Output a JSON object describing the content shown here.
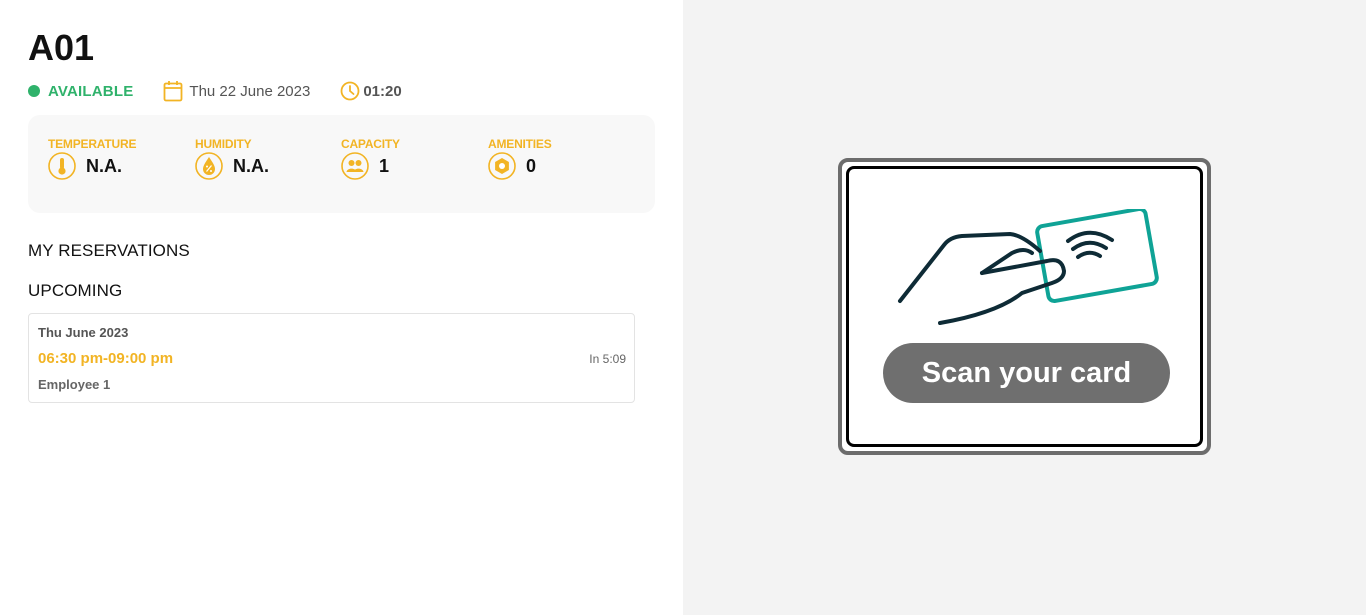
{
  "room": {
    "name": "A01",
    "status": "AVAILABLE",
    "date": "Thu 22 June 2023",
    "time": "01:20"
  },
  "stats": [
    {
      "label": "TEMPERATURE",
      "value": "N.A.",
      "icon": "thermometer-icon"
    },
    {
      "label": "HUMIDITY",
      "value": "N.A.",
      "icon": "humidity-drop-icon"
    },
    {
      "label": "CAPACITY",
      "value": "1",
      "icon": "people-icon"
    },
    {
      "label": "AMENITIES",
      "value": "0",
      "icon": "amenities-icon"
    }
  ],
  "reservations": {
    "heading": "MY RESERVATIONS",
    "upcoming_heading": "UPCOMING",
    "items": [
      {
        "date": "Thu June 2023",
        "time_range": "06:30 pm-09:00 pm",
        "countdown": "In 5:09",
        "user": "Employee 1"
      }
    ]
  },
  "scan": {
    "label": "Scan your card",
    "illustration": "hand-tapping-card-icon"
  },
  "colors": {
    "accent": "#f2b424",
    "available": "#2fb26b",
    "card_outline": "#0fa396",
    "hand_outline": "#0e2b36",
    "button": "#6f6f6f"
  }
}
